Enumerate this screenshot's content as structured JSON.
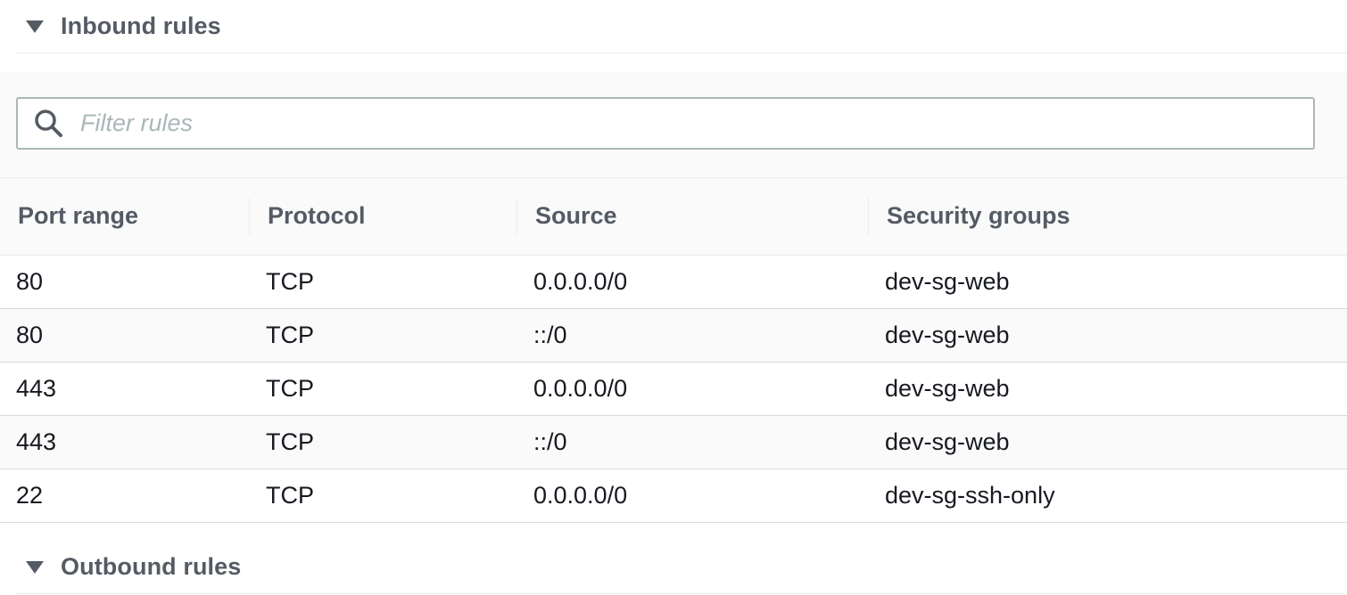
{
  "inbound": {
    "title": "Inbound rules",
    "filter": {
      "placeholder": "Filter rules",
      "value": ""
    },
    "columns": [
      "Port range",
      "Protocol",
      "Source",
      "Security groups"
    ],
    "rows": [
      {
        "port": "80",
        "protocol": "TCP",
        "source": "0.0.0.0/0",
        "security_group": "dev-sg-web"
      },
      {
        "port": "80",
        "protocol": "TCP",
        "source": "::/0",
        "security_group": "dev-sg-web"
      },
      {
        "port": "443",
        "protocol": "TCP",
        "source": "0.0.0.0/0",
        "security_group": "dev-sg-web"
      },
      {
        "port": "443",
        "protocol": "TCP",
        "source": "::/0",
        "security_group": "dev-sg-web"
      },
      {
        "port": "22",
        "protocol": "TCP",
        "source": "0.0.0.0/0",
        "security_group": "dev-sg-ssh-only"
      }
    ]
  },
  "outbound": {
    "title": "Outbound rules"
  },
  "icons": {
    "expand": "caret-down-icon",
    "search": "search-icon"
  },
  "colors": {
    "header_text": "#545b64",
    "body_text": "#16191f",
    "placeholder": "#aab7b8",
    "input_border": "#aab7b8",
    "alt_row_bg": "#fafafa"
  }
}
